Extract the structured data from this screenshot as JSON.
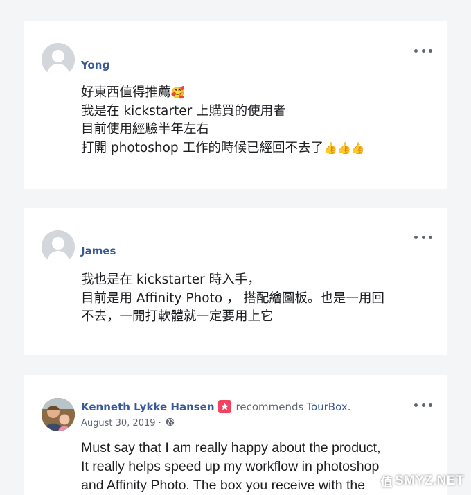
{
  "colors": {
    "page_background": "#f4f5f7",
    "card_background": "#ffffff",
    "author_link": "#385898",
    "body_text": "#1c1e21",
    "secondary_text": "#606770",
    "recommend_badge": "#f3425f"
  },
  "comments": [
    {
      "author": "Yong",
      "avatar": "default-avatar-icon",
      "lines": [
        "好東西值得推薦",
        "我是在 kickstarter 上購買的使用者",
        "目前使用經驗半年左右",
        "打開 photoshop 工作的時候已經回不去了"
      ],
      "emoji_line1": "🥰",
      "emoji_line4": "👍👍👍"
    },
    {
      "author": "James",
      "avatar": "default-avatar-icon",
      "lines": [
        "我也是在 kickstarter 時入手，",
        "目前是用 Affinity Photo ， 搭配繪圖板。也是一用回",
        "不去，一開打軟體就一定要用上它"
      ]
    }
  ],
  "review": {
    "author": "Kenneth Lykke Hansen",
    "action": "recommends",
    "page": "TourBox.",
    "date": "August 30, 2019 ·",
    "privacy_icon": "globe-icon",
    "lines": [
      "Must say that I am really happy about the product,",
      "It really helps speed up my workflow in photoshop",
      "and Affinity Photo. The box you receive with the"
    ]
  },
  "watermark": {
    "glyph": "值",
    "text": "SMYZ.NET"
  }
}
